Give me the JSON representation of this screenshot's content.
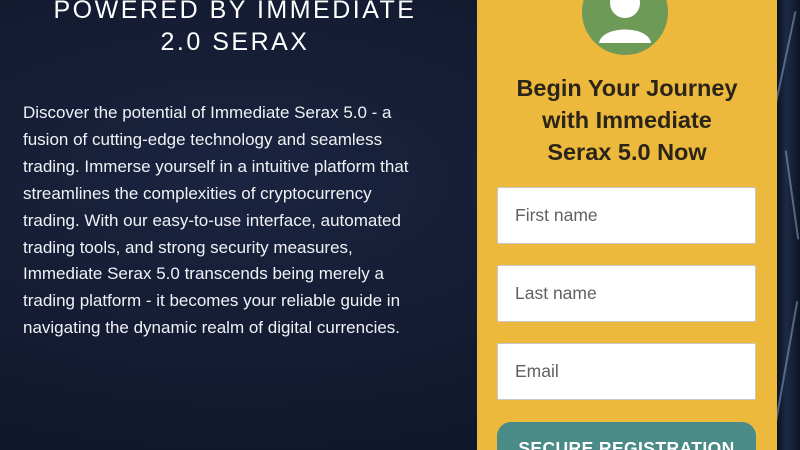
{
  "hero": {
    "title_line1": "POWERED BY IMMEDIATE",
    "title_line2": "2.0 SERAX",
    "body": "Discover the potential of Immediate Serax 5.0 - a fusion of cutting-edge technology and seamless trading. Immerse yourself in a intuitive platform that streamlines the complexities of cryptocurrency trading. With our easy-to-use interface, automated trading tools, and strong security measures, Immediate Serax 5.0 transcends being merely a trading platform - it becomes your reliable guide in navigating the dynamic realm of digital currencies."
  },
  "signup": {
    "title_line1": "Begin Your Journey",
    "title_line2": "with Immediate",
    "title_line3": "Serax 5.0 Now",
    "first_name_placeholder": "First name",
    "last_name_placeholder": "Last name",
    "email_placeholder": "Email",
    "submit_label": "SECURE REGISTRATION"
  },
  "icons": {
    "avatar": "user-avatar-icon"
  },
  "colors": {
    "background": "#131a30",
    "card": "#ecb93d",
    "avatar": "#6e9a57",
    "button": "#4a8a87",
    "title_text": "#2b2418"
  }
}
